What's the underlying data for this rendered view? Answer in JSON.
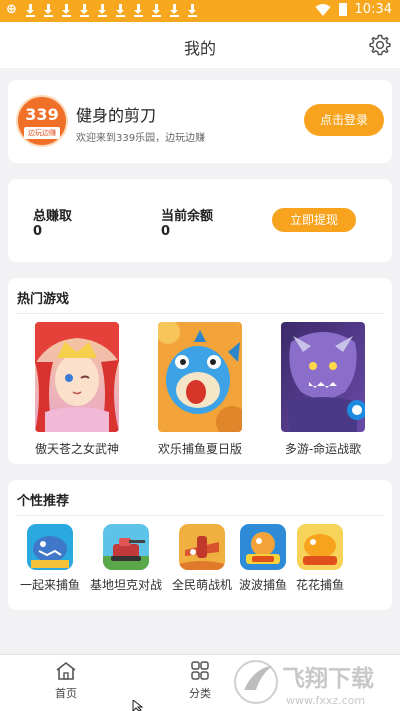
{
  "status_bar": {
    "time": "10:34",
    "download_count": 10
  },
  "header": {
    "title": "我的"
  },
  "profile": {
    "logo_text": "339",
    "logo_sub": "边玩边赚",
    "name": "健身的剪刀",
    "welcome": "欢迎来到339乐园，边玩边赚",
    "login_button": "点击登录"
  },
  "balance": {
    "earned_label": "总赚取",
    "earned_value": "0",
    "current_label": "当前余额",
    "current_value": "0",
    "withdraw_button": "立即提现"
  },
  "hot_games": {
    "title": "热门游戏",
    "items": [
      {
        "name": "傲天苍之女武神"
      },
      {
        "name": "欢乐捕鱼夏日版"
      },
      {
        "name": "多游-命运战歌"
      }
    ]
  },
  "recommend": {
    "title": "个性推荐",
    "items": [
      {
        "name": "一起来捕鱼"
      },
      {
        "name": "基地坦克对战"
      },
      {
        "name": "全民萌战机"
      },
      {
        "name": "波波捕鱼"
      },
      {
        "name": "花花捕鱼"
      }
    ]
  },
  "tabs": [
    {
      "label": "首页"
    },
    {
      "label": "分类"
    }
  ],
  "watermark": {
    "text": "飞翔下载",
    "url": "www.fxxz.com"
  },
  "colors": {
    "accent": "#f7a31e",
    "status_bar": "#f7a81e",
    "background": "#f2f2f5"
  }
}
